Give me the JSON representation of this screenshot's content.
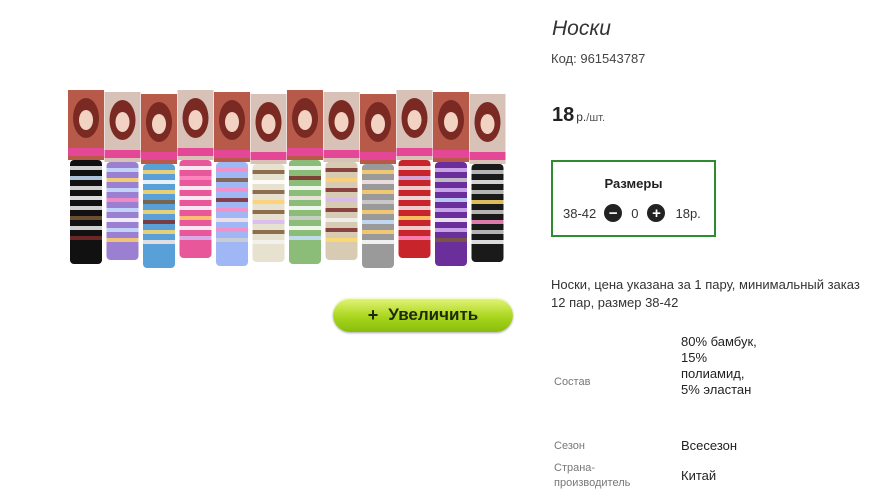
{
  "product": {
    "title": "Носки",
    "code_label": "Код:",
    "code_value": "961543787",
    "price_value": "18",
    "price_currency": "р.",
    "price_unit": "/шт."
  },
  "zoom_button": {
    "icon": "plus",
    "label": "Увеличить"
  },
  "sizes": {
    "title": "Размеры",
    "rows": [
      {
        "size": "38-42",
        "quantity": "0",
        "price": "18р."
      }
    ]
  },
  "description": "Носки, цена указана за 1 пару, минимальный заказ 12 пар, размер 38-42",
  "specs": {
    "composition": {
      "label": "Состав",
      "value": "80% бамбук, 15% полиамид, 5% эластан"
    },
    "season": {
      "label": "Сезон",
      "value": "Всесезон"
    },
    "country": {
      "label": "Страна-производитель",
      "value": "Китай"
    }
  },
  "image": {
    "sock_colors": [
      "#111111",
      "#9b7fd1",
      "#5aa0d8",
      "#e8579a",
      "#9fb7f5",
      "#e7e1d0",
      "#8cbd78",
      "#d8cbb4",
      "#9a9a9a",
      "#c8242c",
      "#6a2f9b",
      "#1a1a1a"
    ],
    "stripe_accents": [
      "#f3f3f3",
      "#c8e2ff",
      "#ffd96a",
      "#ffffff",
      "#ff8cc3",
      "#7d5a3a",
      "#ffffff",
      "#7b2b2b",
      "#ffcf6b",
      "#f8e8e8",
      "#d7b9f5",
      "#d0d0d0"
    ]
  }
}
